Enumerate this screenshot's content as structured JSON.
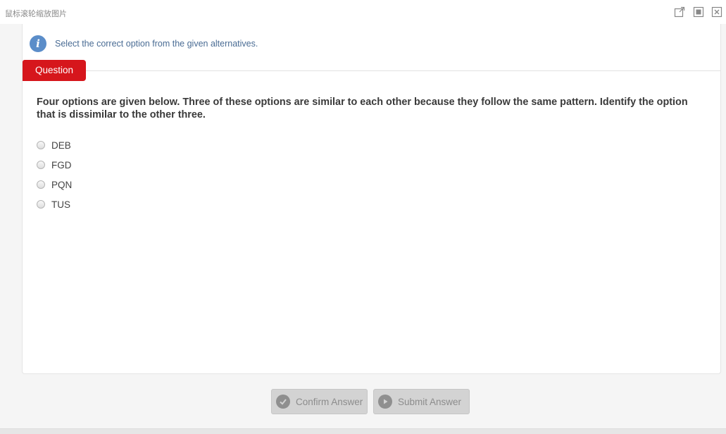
{
  "window": {
    "title": "鼠标滚轮缩放图片"
  },
  "info": {
    "icon": "info-icon",
    "text": "Select the correct option from the given alternatives."
  },
  "question": {
    "tab_label": "Question",
    "text": "Four options are given below. Three of these options are similar to each other because they follow the same pattern. Identify the option that is dissimilar to the other three.",
    "options": [
      "DEB",
      "FGD",
      "PQN",
      "TUS"
    ]
  },
  "buttons": {
    "confirm_label": "Confirm Answer",
    "submit_label": "Submit Answer"
  },
  "colors": {
    "tab_red": "#d6161c",
    "info_blue": "#5b8dc9",
    "button_gray": "#d3d3d3"
  }
}
